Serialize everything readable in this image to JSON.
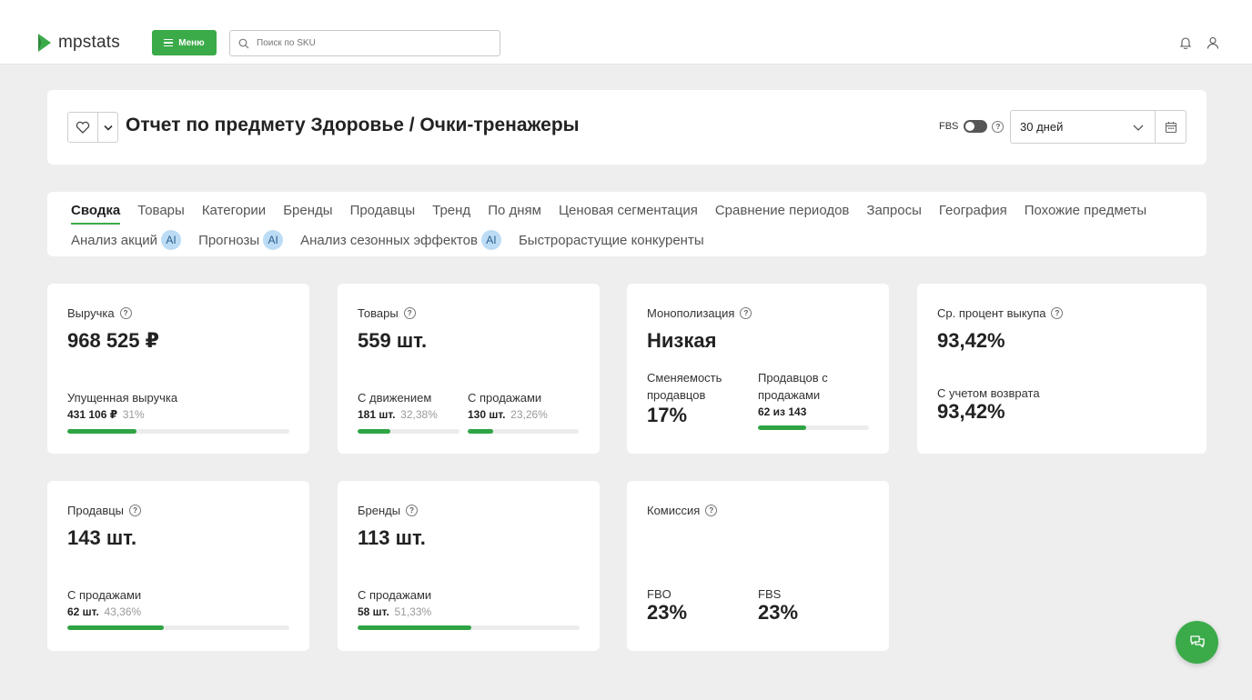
{
  "app": {
    "name": "mpstats"
  },
  "topbar": {
    "menu_label": "Меню",
    "search_placeholder": "Поиск по SKU"
  },
  "header": {
    "title": "Отчет по предмету Здоровье / Очки-тренажеры",
    "fbs_label": "FBS",
    "period": "30 дней"
  },
  "tabs_row1": [
    "Сводка",
    "Товары",
    "Категории",
    "Бренды",
    "Продавцы",
    "Тренд",
    "По дням",
    "Ценовая сегментация",
    "Сравнение периодов",
    "Запросы",
    "География",
    "Похожие предметы"
  ],
  "tabs_row2": [
    {
      "label": "Анализ акций",
      "badge": "AI"
    },
    {
      "label": "Прогнозы",
      "badge": "AI"
    },
    {
      "label": "Анализ сезонных эффектов",
      "badge": "AI"
    },
    {
      "label": "Быстрорастущие конкуренты",
      "badge": ""
    }
  ],
  "cards": {
    "revenue": {
      "label": "Выручка",
      "value": "968 525 ₽",
      "sub_label": "Упущенная выручка",
      "sub_value": "431 106 ₽",
      "sub_pct": "31%",
      "progress": 0.31
    },
    "goods": {
      "label": "Товары",
      "value": "559 шт.",
      "left_label": "С движением",
      "left_value": "181 шт.",
      "left_pct": "32,38%",
      "left_progress": 0.3238,
      "right_label": "С продажами",
      "right_value": "130 шт.",
      "right_pct": "23,26%",
      "right_progress": 0.2326
    },
    "monopoly": {
      "label": "Монополизация",
      "value": "Низкая",
      "left_label": "Сменяемость продавцов",
      "left_value": "17%",
      "right_label": "Продавцов с продажами",
      "right_value": "62 из 143",
      "right_progress": 0.4336
    },
    "buyout": {
      "label": "Ср. процент выкупа",
      "value": "93,42%",
      "sub_label": "С учетом возврата",
      "sub_value": "93,42%"
    },
    "sellers": {
      "label": "Продавцы",
      "value": "143 шт.",
      "sub_label": "С продажами",
      "sub_value": "62 шт.",
      "sub_pct": "43,36%",
      "progress": 0.4336
    },
    "brands": {
      "label": "Бренды",
      "value": "113 шт.",
      "sub_label": "С продажами",
      "sub_value": "58 шт.",
      "sub_pct": "51,33%",
      "progress": 0.5133
    },
    "commission": {
      "label": "Комиссия",
      "fbo_label": "FBO",
      "fbo_value": "23%",
      "fbs_label": "FBS",
      "fbs_value": "23%"
    }
  },
  "colors": {
    "accent": "#3bab4a",
    "progress": "#2ea443",
    "ai_badge": "#bcdcf5"
  }
}
